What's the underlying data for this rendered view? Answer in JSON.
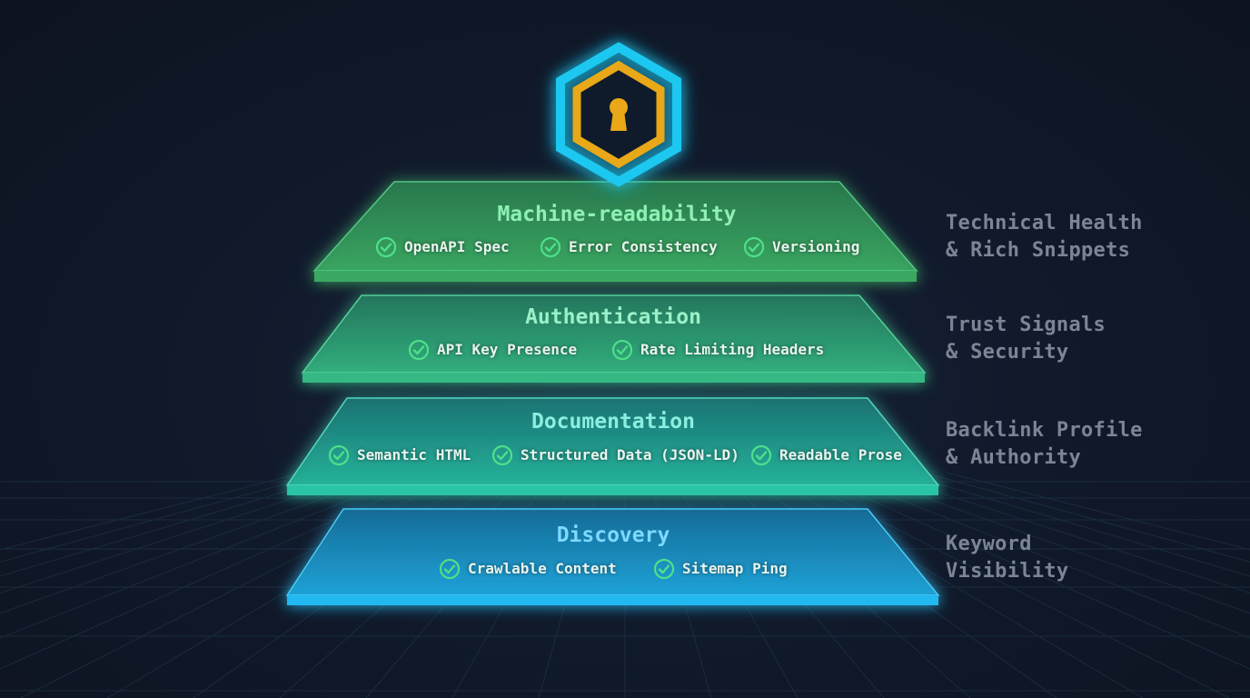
{
  "colors": {
    "background": "#101726",
    "machine": "#2f9a5a",
    "authentication": "#2ea878",
    "documentation": "#1fae98",
    "discovery": "#1b9bd0",
    "check": "#4ee08a",
    "hex_outer": "#1ec8f0",
    "hex_inner": "#e8a817",
    "side_text": "#7c8593"
  },
  "icon": {
    "name": "keyhole-shield-icon"
  },
  "layers": [
    {
      "id": "machine",
      "title": "Machine-readability",
      "items": [
        "OpenAPI Spec",
        "Error Consistency",
        "Versioning"
      ],
      "side_label": [
        "Technical Health",
        "& Rich Snippets"
      ]
    },
    {
      "id": "authentication",
      "title": "Authentication",
      "items": [
        "API Key Presence",
        "Rate Limiting Headers"
      ],
      "side_label": [
        "Trust Signals",
        "& Security"
      ]
    },
    {
      "id": "documentation",
      "title": "Documentation",
      "items": [
        "Semantic HTML",
        "Structured Data (JSON-LD)",
        "Readable Prose"
      ],
      "side_label": [
        "Backlink Profile",
        "& Authority"
      ]
    },
    {
      "id": "discovery",
      "title": "Discovery",
      "items": [
        "Crawlable Content",
        "Sitemap Ping"
      ],
      "side_label": [
        "Keyword",
        "Visibility"
      ]
    }
  ]
}
